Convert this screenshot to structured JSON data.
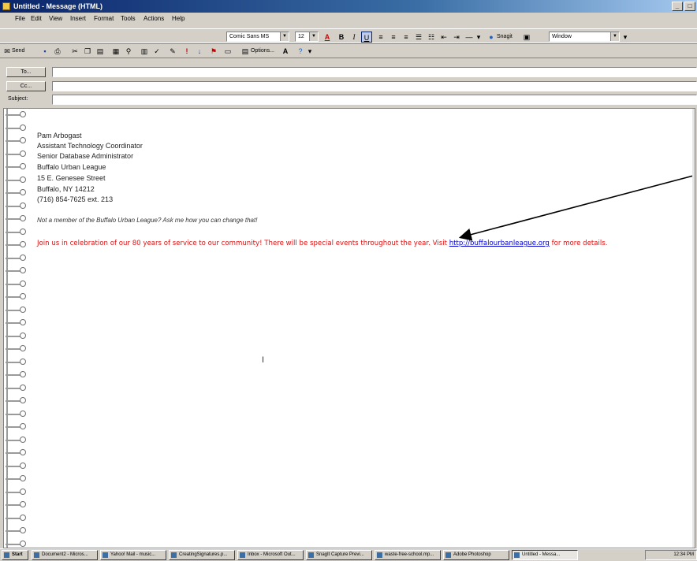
{
  "window": {
    "title": "Untitled - Message (HTML)"
  },
  "menu": [
    {
      "label": "File"
    },
    {
      "label": "Edit"
    },
    {
      "label": "View"
    },
    {
      "label": "Insert"
    },
    {
      "label": "Format"
    },
    {
      "label": "Tools"
    },
    {
      "label": "Actions"
    },
    {
      "label": "Help"
    }
  ],
  "format_toolbar": {
    "font": "Comic Sans MS",
    "size": "12",
    "snagit_label": "Snagit",
    "capture_mode": "Window"
  },
  "standard_toolbar": {
    "send_label": "Send",
    "options_label": "Options..."
  },
  "header": {
    "to_label": "To...",
    "cc_label": "Cc...",
    "subject_label": "Subject:",
    "to_value": "",
    "cc_value": "",
    "subject_value": ""
  },
  "signature": {
    "lines": [
      "Pam Arbogast",
      "Assistant Technology Coordinator",
      "Senior Database Administrator",
      "Buffalo Urban League",
      "15 E. Genesee Street",
      "Buffalo, NY  14212",
      "(716) 854-7625 ext. 213"
    ],
    "tagline": "Not a member of the Buffalo Urban League?  Ask me how you can change that!"
  },
  "promo": {
    "text_before_link": "Join us in celebration of our 80 years of service to our community!  There will be special events throughout the year.   Visit ",
    "link": "http://buffalourbanleague.org",
    "text_after_link": " for more details."
  },
  "taskbar": {
    "start_label": "Start",
    "items": [
      "Document2 - Micros...",
      "Yahoo! Mail - music...",
      "CreatingSignatures.p...",
      "Inbox - Microsoft Out...",
      "SnagIt Capture Previ...",
      "waste-free-school.mp...",
      "Adobe Photoshop",
      "Untitled - Messa..."
    ],
    "clock": "12:34 PM"
  }
}
